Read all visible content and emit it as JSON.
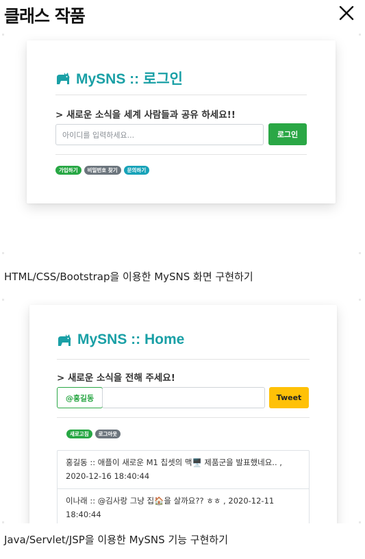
{
  "header": {
    "title": "클래스 작품",
    "close_icon": "close-icon"
  },
  "projects": [
    {
      "screenshot": {
        "brand_icon": "cat-icon",
        "brand_text": "MySNS :: 로그인",
        "tagline": "> 새로운 소식을 세계 사람들과 공유 하세요!!",
        "id_input_placeholder": "아이디를 입력하세요...",
        "login_button": "로그인",
        "pills": [
          "가입하기",
          "비밀번호 찾기",
          "문의하기"
        ]
      },
      "caption": "HTML/CSS/Bootstrap을 이용한 MySNS 화면 구현하기"
    },
    {
      "screenshot": {
        "brand_icon": "cat-icon",
        "brand_text": "MySNS :: Home",
        "tagline": "> 새로운 소식을 전해 주세요!",
        "user_tag": "@홍길동",
        "message_input_value": "",
        "tweet_button": "Tweet",
        "pills": [
          "새로고침",
          "로그아웃"
        ],
        "posts": [
          {
            "line1": "홍길동 :: 애플이 새로운 M1 칩셋의 맥🖥️ 제품군을 발표했네요.. ,",
            "line2": "2020-12-16 18:40:44"
          },
          {
            "line1": "이나래 :: @김사랑 그냥 집🏠을 살까요?? ㅎㅎ , 2020-12-11",
            "line2": "18:40:44"
          }
        ]
      },
      "caption": "Java/Servlet/JSP을 이용한 MySNS 기능 구현하기"
    }
  ],
  "colors": {
    "brand": "#1aa0a6",
    "success": "#2aa745",
    "warning": "#ffc107",
    "secondary": "#6c757d",
    "info": "#17a2b8"
  }
}
